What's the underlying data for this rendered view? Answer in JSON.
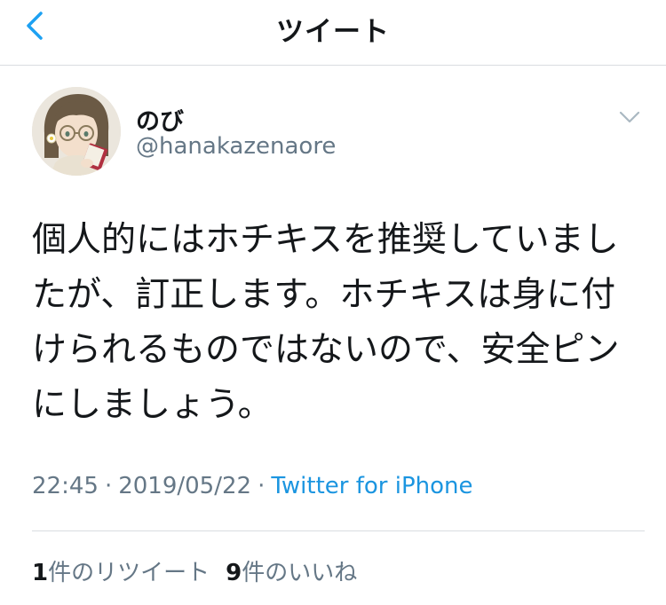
{
  "navbar": {
    "title": "ツイート",
    "back_icon": "chevron-left-icon",
    "accent_color": "#1da1f2"
  },
  "tweet": {
    "author": {
      "display_name": "のび",
      "handle": "@hanakazenaore",
      "avatar": "illustrated-avatar-girl-with-glasses"
    },
    "menu_icon": "chevron-down-icon",
    "text": "個人的にはホチキスを推奨していましたが、訂正します。ホチキスは身に付けられるものではないので、安全ピンにしましょう。",
    "time": "22:45",
    "separator": "·",
    "date": "2019/05/22",
    "source": "Twitter for iPhone",
    "source_color": "#1b95e0"
  },
  "stats": {
    "retweets": {
      "count": "1",
      "label": "件のリツイート"
    },
    "likes": {
      "count": "9",
      "label": "件のいいね"
    }
  }
}
